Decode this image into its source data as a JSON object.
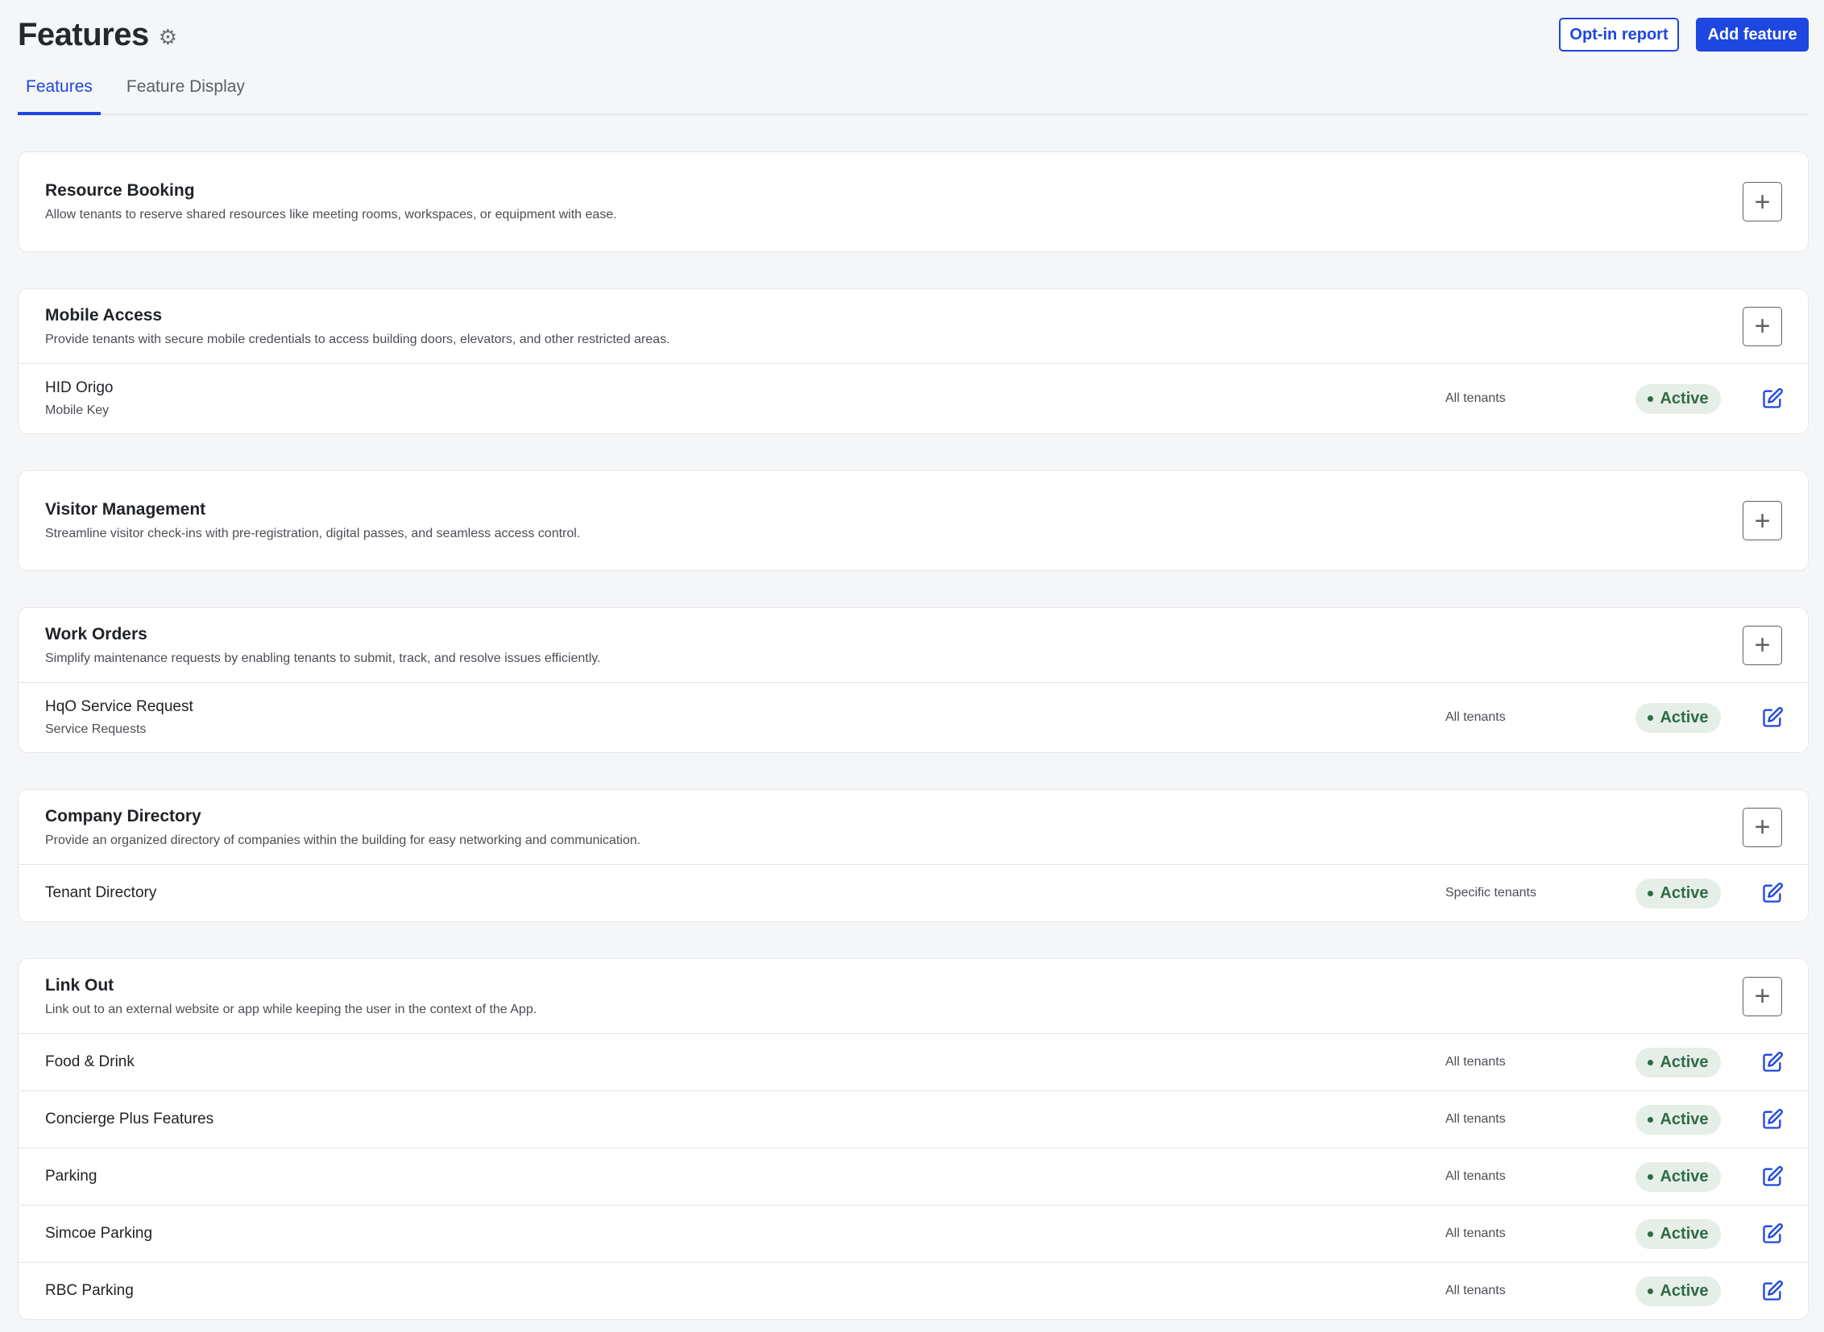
{
  "header": {
    "title": "Features",
    "gear_icon": "gear-icon",
    "opt_in_label": "Opt-in report",
    "add_label": "Add feature"
  },
  "tabs": [
    {
      "label": "Features",
      "active": true
    },
    {
      "label": "Feature Display",
      "active": false
    }
  ],
  "colors": {
    "accent": "#1d47e0",
    "active_bg": "#e6eee8",
    "active_text": "#2e6b45"
  },
  "groups": [
    {
      "title": "Resource Booking",
      "desc": "Allow tenants to reserve shared resources like meeting rooms, workspaces, or equipment with ease.",
      "items": []
    },
    {
      "title": "Mobile Access",
      "desc": "Provide tenants with secure mobile credentials to access building doors, elevators, and other restricted areas.",
      "items": [
        {
          "name": "HID Origo",
          "sub": "Mobile Key",
          "scope": "All tenants",
          "status": "Active"
        }
      ]
    },
    {
      "title": "Visitor Management",
      "desc": "Streamline visitor check-ins with pre-registration, digital passes, and seamless access control.",
      "items": []
    },
    {
      "title": "Work Orders",
      "desc": "Simplify maintenance requests by enabling tenants to submit, track, and resolve issues efficiently.",
      "items": [
        {
          "name": "HqO Service Request",
          "sub": "Service Requests",
          "scope": "All tenants",
          "status": "Active"
        }
      ]
    },
    {
      "title": "Company Directory",
      "desc": "Provide an organized directory of companies within the building for easy networking and communication.",
      "items": [
        {
          "name": "Tenant Directory",
          "scope": "Specific tenants",
          "status": "Active"
        }
      ]
    },
    {
      "title": "Link Out",
      "desc": "Link out to an external website or app while keeping the user in the context of the App.",
      "items": [
        {
          "name": "Food & Drink",
          "scope": "All tenants",
          "status": "Active"
        },
        {
          "name": "Concierge Plus Features",
          "scope": "All tenants",
          "status": "Active"
        },
        {
          "name": "Parking",
          "scope": "All tenants",
          "status": "Active"
        },
        {
          "name": "Simcoe Parking",
          "scope": "All tenants",
          "status": "Active"
        },
        {
          "name": "RBC Parking",
          "scope": "All tenants",
          "status": "Active"
        }
      ]
    }
  ]
}
